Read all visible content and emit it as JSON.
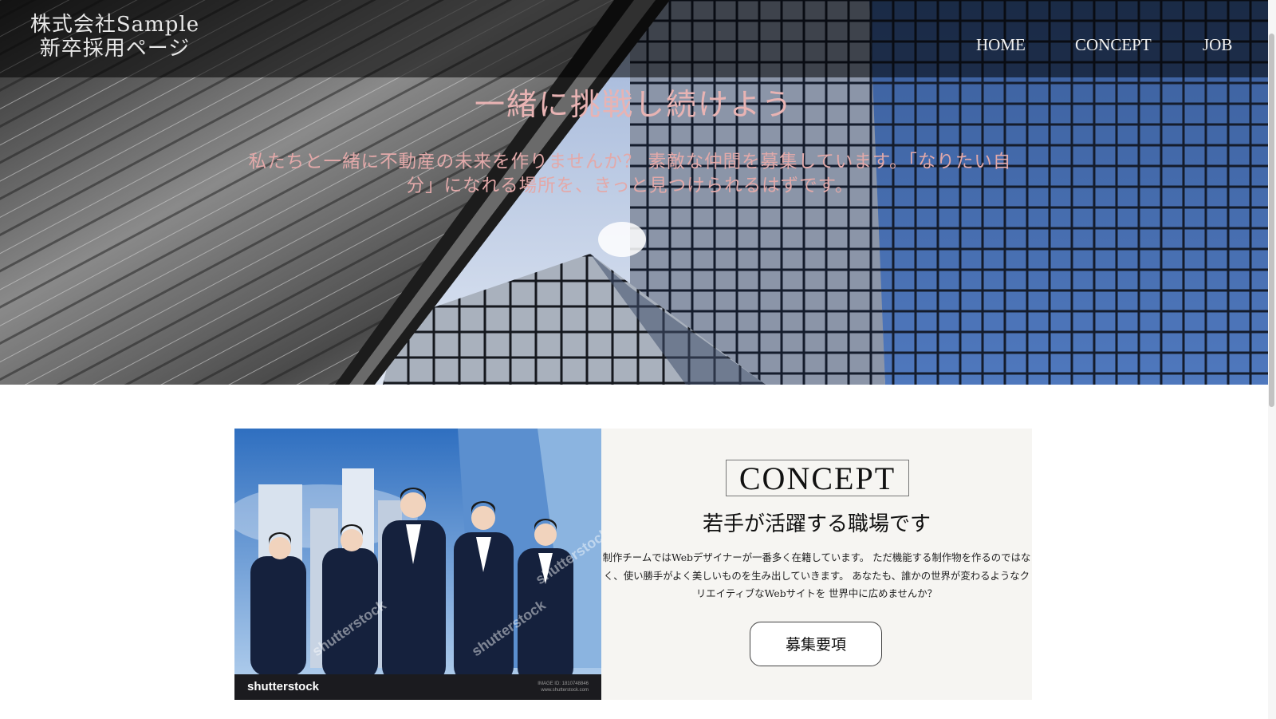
{
  "header": {
    "logo_line1": "株式会社Sample",
    "logo_line2": "新卒採用ページ",
    "nav": [
      {
        "label": "HOME"
      },
      {
        "label": "CONCEPT"
      },
      {
        "label": "JOB"
      }
    ]
  },
  "hero": {
    "title": "一緒に挑戦し続けよう",
    "text": "私たちと一緒に不動産の未来を作りませんか？ 素敵な仲間を募集しています。「なりたい自分」になれる場所を、きっと見つけられるはずです。",
    "title_color": "#e8b3b3"
  },
  "concept": {
    "label": "CONCEPT",
    "heading": "若手が活躍する職場です",
    "body": "制作チームではWebデザイナーが一番多く在籍しています。 ただ機能する制作物を作るのではなく、使い勝手がよく美しいものを生み出していきます。 あなたも、誰かの世界が変わるようなクリエイティブなWebサイトを 世界中に広めませんか？",
    "button_label": "募集要項"
  },
  "photo": {
    "watermark_logo": "shutterstock",
    "watermark_text": "shutterstock",
    "image_id_label": "IMAGE ID: 1810748846",
    "image_site": "www.shutterstock.com"
  }
}
